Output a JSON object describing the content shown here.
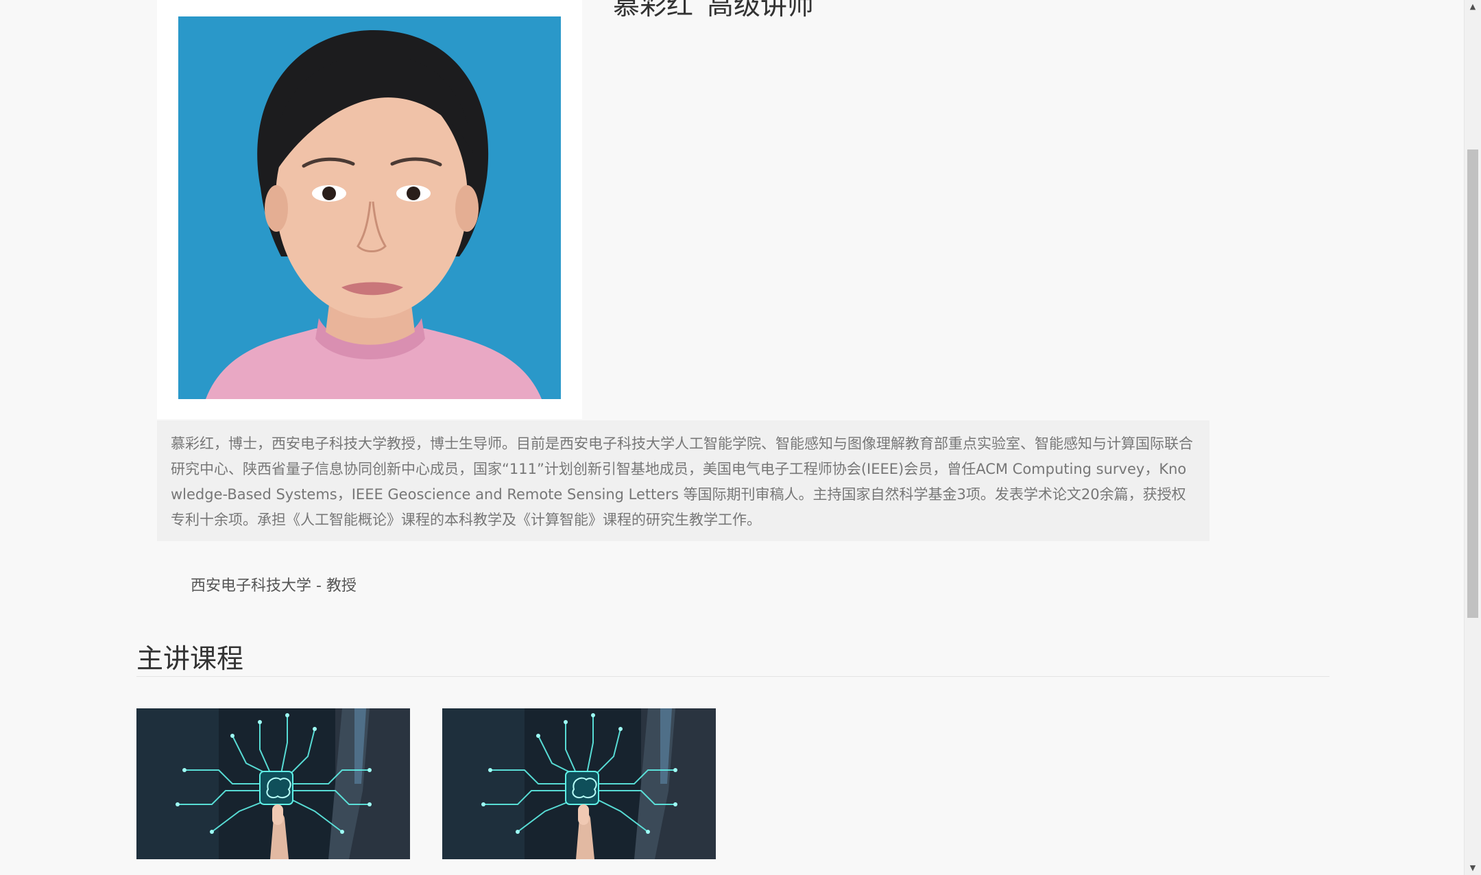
{
  "profile": {
    "name": "慕彩红",
    "title": "高级讲师",
    "bio": "慕彩红，博士，西安电子科技大学教授，博士生导师。目前是西安电子科技大学人工智能学院、智能感知与图像理解教育部重点实验室、智能感知与计算国际联合研究中心、陕西省量子信息协同创新中心成员，国家“111”计划创新引智基地成员，美国电气电子工程师协会(IEEE)会员，曾任ACM Computing survey，Knowledge-Based Systems，IEEE Geoscience and Remote Sensing Letters 等国际期刊审稿人。主持国家自然科学基金3项。发表学术论文20余篇，获授权专利十余项。承担《人工智能概论》课程的本科教学及《计算智能》课程的研究生教学工作。",
    "affiliation": "西安电子科技大学 - 教授"
  },
  "courses_section": {
    "heading": "主讲课程",
    "courses": [
      {
        "image": "ai-brain-circuit-image"
      },
      {
        "image": "ai-brain-circuit-image"
      }
    ]
  },
  "colors": {
    "photo_background": "#2a98c9",
    "bio_background": "#f0f0f0",
    "page_background": "#f8f8f8",
    "circuit_glow": "#5ff0e6"
  },
  "icons": {
    "scroll_up": "▲",
    "scroll_down": "▼"
  }
}
